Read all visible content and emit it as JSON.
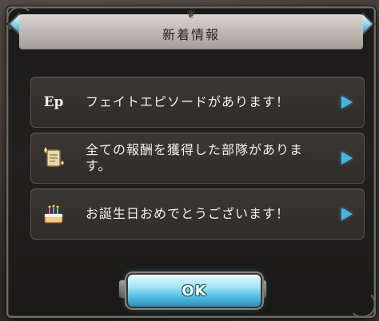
{
  "dialog": {
    "title": "新着情報",
    "items": [
      {
        "icon": "ep-icon",
        "icon_label": "Ep",
        "text": "フェイトエピソードがあります！"
      },
      {
        "icon": "scroll-reward-icon",
        "text": "全ての報酬を獲得した部隊があります。"
      },
      {
        "icon": "birthday-cake-icon",
        "text": "お誕生日おめでとうございます！"
      }
    ],
    "ok_label": "OK"
  },
  "colors": {
    "arrow": "#3fb6e6",
    "ok_button": "#9fe3f5",
    "title_bar": "#c9c4be",
    "row_bg": "#34312e"
  }
}
